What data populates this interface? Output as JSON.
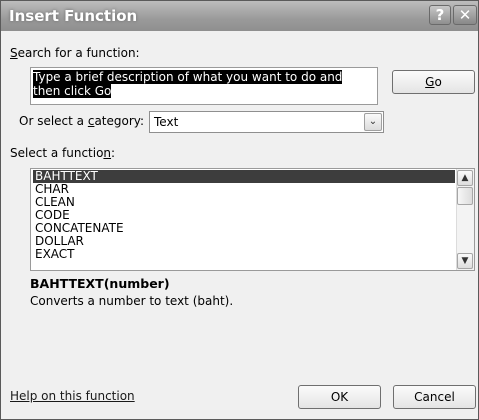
{
  "window": {
    "title": "Insert Function",
    "help_glyph": "?",
    "close_glyph": "✕"
  },
  "search": {
    "label_prefix": "S",
    "label_rest": "earch for a function:",
    "query": "Type a brief description of what you want to do and then click Go",
    "go_accel": "G",
    "go_rest": "o"
  },
  "category": {
    "label_pre": "Or select a ",
    "label_accel": "c",
    "label_post": "ategory:",
    "value": "Text",
    "arrow_glyph": "⌄"
  },
  "functions": {
    "label_pre": "Select a functio",
    "label_accel": "n",
    "label_post": ":",
    "items": [
      "BAHTTEXT",
      "CHAR",
      "CLEAN",
      "CODE",
      "CONCATENATE",
      "DOLLAR",
      "EXACT"
    ],
    "selected_index": 0,
    "scroll_up_glyph": "▲",
    "scroll_down_glyph": "▼"
  },
  "details": {
    "signature": "BAHTTEXT(number)",
    "description": "Converts a number to text (baht)."
  },
  "footer": {
    "help_link": "Help on this function",
    "ok_label": "OK",
    "cancel_label": "Cancel"
  }
}
